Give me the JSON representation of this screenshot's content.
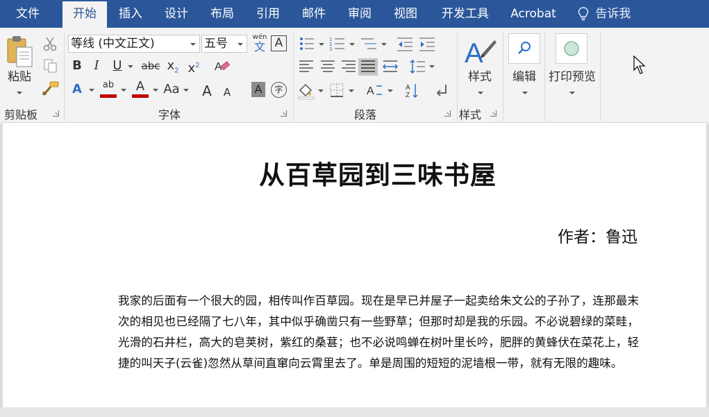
{
  "tabs": [
    {
      "label": "文件",
      "active": false
    },
    {
      "label": "开始",
      "active": true
    },
    {
      "label": "插入",
      "active": false
    },
    {
      "label": "设计",
      "active": false
    },
    {
      "label": "布局",
      "active": false
    },
    {
      "label": "引用",
      "active": false
    },
    {
      "label": "邮件",
      "active": false
    },
    {
      "label": "审阅",
      "active": false
    },
    {
      "label": "视图",
      "active": false
    },
    {
      "label": "开发工具",
      "active": false
    },
    {
      "label": "Acrobat",
      "active": false
    }
  ],
  "tell_me": "告诉我",
  "clipboard": {
    "paste_label": "粘贴",
    "group_label": "剪贴板"
  },
  "font": {
    "font_name": "等线 (中文正文)",
    "font_size": "五号",
    "phonetic_top": "wén",
    "phonetic_bottom": "文",
    "border_char": "A",
    "bold": "B",
    "italic": "I",
    "underline": "U",
    "strike": "abc",
    "subscript_base": "x",
    "subscript_mark": "2",
    "superscript_base": "x",
    "superscript_mark": "2",
    "text_effect": "A",
    "highlight_mark": "ab",
    "font_color": "A",
    "change_case": "Aa",
    "grow": "A",
    "shrink": "A",
    "char_shading": "A",
    "enclose": "字",
    "group_label": "字体"
  },
  "paragraph": {
    "group_label": "段落",
    "sort": "A Z"
  },
  "styles": {
    "button_label": "样式",
    "group_label": "样式"
  },
  "editing": {
    "button_label": "编辑"
  },
  "print_preview": {
    "button_label": "打印预览"
  },
  "colors": {
    "tabbar": "#2b579a",
    "ribbon": "#f3f3f3",
    "highlight_red": "#c00000",
    "font_color_red": "#c00000",
    "accent_blue": "#2f6fc5"
  },
  "document": {
    "title": "从百草园到三味书屋",
    "author": "作者：鲁迅",
    "body": "我家的后面有一个很大的园，相传叫作百草园。现在是早已并屋子一起卖给朱文公的子孙了，连那最末次的相见也已经隔了七八年，其中似乎确凿只有一些野草；但那时却是我的乐园。不必说碧绿的菜畦，光滑的石井栏，高大的皂荚树，紫红的桑葚；也不必说鸣蝉在树叶里长吟，肥胖的黄蜂伏在菜花上，轻捷的叫天子(云雀)忽然从草间直窜向云霄里去了。单是周围的短短的泥墙根一带，就有无限的趣味。"
  }
}
